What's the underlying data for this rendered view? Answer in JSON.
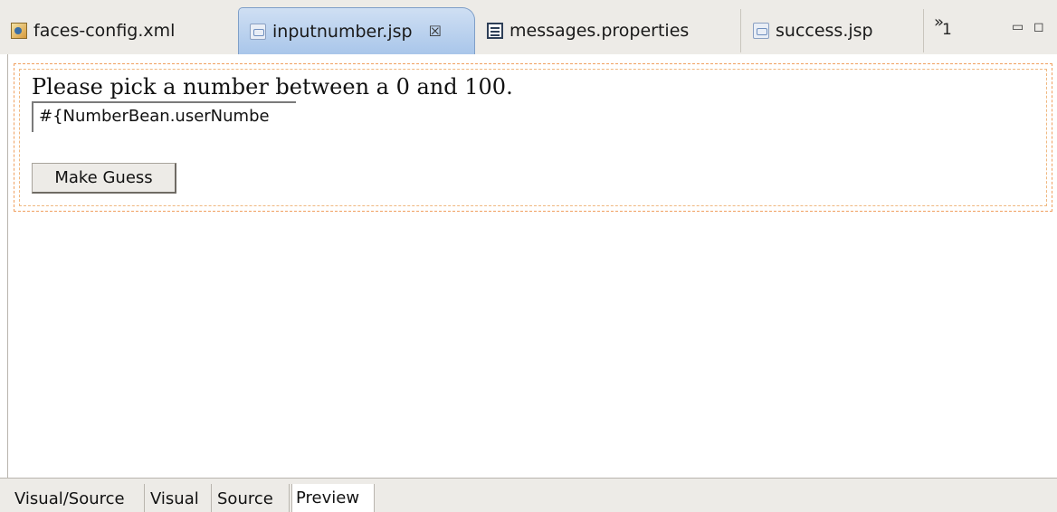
{
  "editor_tabs": [
    {
      "label": "faces-config.xml",
      "icon": "faces-config-file-icon"
    },
    {
      "label": "inputnumber.jsp",
      "icon": "jsp-file-icon",
      "close": "☒"
    },
    {
      "label": "messages.properties",
      "icon": "properties-file-icon"
    },
    {
      "label": "success.jsp",
      "icon": "jsp-file-icon"
    }
  ],
  "overflow": {
    "chevron": "»",
    "count": "1"
  },
  "window_controls": {
    "minimize": "▭",
    "maximize": "◻"
  },
  "page": {
    "prompt": "Please pick a number between a 0 and 100.",
    "input_value": "#{NumberBean.userNumbe",
    "button_label": "Make Guess"
  },
  "bottom_tabs": [
    "Visual/Source",
    "Visual",
    "Source",
    "Preview"
  ],
  "colors": {
    "active_tab": "#a9c6ea",
    "jsf_border": "#f0a060"
  }
}
